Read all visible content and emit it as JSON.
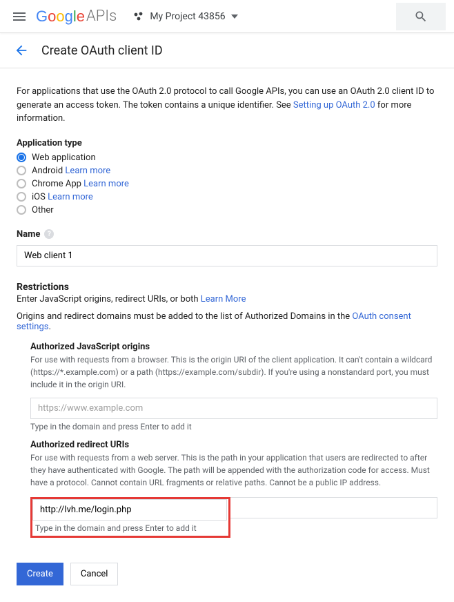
{
  "topbar": {
    "logo_apis": "APIs",
    "project_name": "My Project 43856"
  },
  "header": {
    "title": "Create OAuth client ID"
  },
  "intro": {
    "text_before": "For applications that use the OAuth 2.0 protocol to call Google APIs, you can use an OAuth 2.0 client ID to generate an access token. The token contains a unique identifier. See ",
    "link": "Setting up OAuth 2.0",
    "text_after": " for more information."
  },
  "app_type": {
    "label": "Application type",
    "options": [
      {
        "label": "Web application",
        "selected": true,
        "learn_more": null
      },
      {
        "label": "Android",
        "selected": false,
        "learn_more": "Learn more"
      },
      {
        "label": "Chrome App",
        "selected": false,
        "learn_more": "Learn more"
      },
      {
        "label": "iOS",
        "selected": false,
        "learn_more": "Learn more"
      },
      {
        "label": "Other",
        "selected": false,
        "learn_more": null
      }
    ]
  },
  "name": {
    "label": "Name",
    "value": "Web client 1"
  },
  "restrictions": {
    "title": "Restrictions",
    "desc_before": "Enter JavaScript origins, redirect URIs, or both ",
    "desc_link": "Learn More",
    "note_before": "Origins and redirect domains must be added to the list of Authorized Domains in the ",
    "note_link": "OAuth consent settings",
    "note_after": ".",
    "js_origins": {
      "label": "Authorized JavaScript origins",
      "desc": "For use with requests from a browser. This is the origin URI of the client application. It can't contain a wildcard (https://*.example.com) or a path (https://example.com/subdir). If you're using a nonstandard port, you must include it in the origin URI.",
      "placeholder": "https://www.example.com",
      "hint": "Type in the domain and press Enter to add it"
    },
    "redirect_uris": {
      "label": "Authorized redirect URIs",
      "desc": "For use with requests from a web server. This is the path in your application that users are redirected to after they have authenticated with Google. The path will be appended with the authorization code for access. Must have a protocol. Cannot contain URL fragments or relative paths. Cannot be a public IP address.",
      "value": "http://lvh.me/login.php",
      "hint": "Type in the domain and press Enter to add it"
    }
  },
  "buttons": {
    "create": "Create",
    "cancel": "Cancel"
  }
}
